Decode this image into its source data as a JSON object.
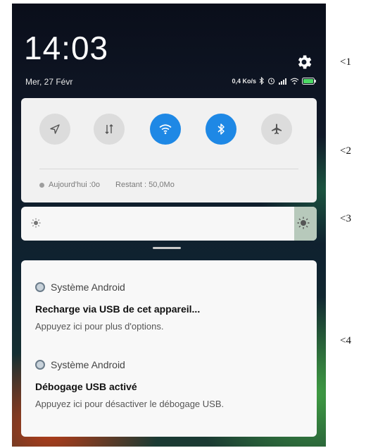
{
  "status_bar": {
    "time": "14:03",
    "date": "Mer, 27 Févr",
    "network_speed": "0,4 Ko/s"
  },
  "quick_settings": {
    "toggles": [
      {
        "icon": "location-icon",
        "active": false
      },
      {
        "icon": "mobile-data-icon",
        "active": false
      },
      {
        "icon": "wifi-icon",
        "active": true
      },
      {
        "icon": "bluetooth-icon",
        "active": true
      },
      {
        "icon": "airplane-mode-icon",
        "active": false
      }
    ],
    "data_usage": {
      "today": "Aujourd'hui :0o",
      "remaining": "Restant : 50,0Mo"
    }
  },
  "brightness": {
    "level": 0.93
  },
  "notifications": [
    {
      "app": "Système Android",
      "title": "Recharge via USB de cet appareil...",
      "text": "Appuyez ici pour plus d'options."
    },
    {
      "app": "Système Android",
      "title": "Débogage USB activé",
      "text": "Appuyez ici pour désactiver le débogage USB."
    }
  ],
  "annotations": [
    "<1",
    "<2",
    "<3",
    "<4"
  ],
  "colors": {
    "accent": "#1e88e5",
    "card": "#f1f1f1",
    "toggle_off": "#dcdcdc"
  }
}
